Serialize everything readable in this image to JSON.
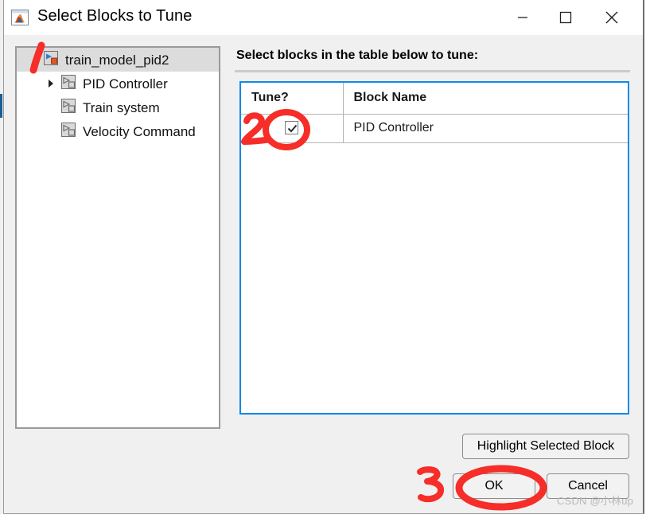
{
  "window": {
    "title": "Select Blocks to Tune",
    "app_icon": "simulink-icon",
    "controls": {
      "minimize_label": "Minimize",
      "maximize_label": "Maximize",
      "close_label": "Close"
    }
  },
  "tree": {
    "items": [
      {
        "label": "train_model_pid2",
        "icon": "simulink-model-icon",
        "selected": true,
        "depth": 0,
        "expandable": false,
        "expanded": false
      },
      {
        "label": "PID Controller",
        "icon": "simulink-block-icon",
        "selected": false,
        "depth": 1,
        "expandable": true,
        "expanded": false
      },
      {
        "label": "Train system",
        "icon": "simulink-block-icon",
        "selected": false,
        "depth": 1,
        "expandable": false,
        "expanded": false
      },
      {
        "label": "Velocity Command",
        "icon": "simulink-block-icon",
        "selected": false,
        "depth": 1,
        "expandable": false,
        "expanded": false
      }
    ]
  },
  "main": {
    "caption": "Select blocks in the table below to tune:",
    "table": {
      "columns": [
        "Tune?",
        "Block Name"
      ],
      "rows": [
        {
          "tune_checked": true,
          "block_name": "PID Controller"
        }
      ]
    }
  },
  "buttons": {
    "highlight": "Highlight Selected Block",
    "ok": "OK",
    "cancel": "Cancel"
  },
  "annotations": {
    "marks": [
      {
        "name": "stroke-1",
        "label": "1"
      },
      {
        "name": "circle-2",
        "label": "2"
      },
      {
        "name": "circle-3",
        "label": "3"
      }
    ],
    "color": "#f62d28"
  },
  "watermark": {
    "text": "CSDN @小林up"
  },
  "colors": {
    "accent_blue": "#0f8cea",
    "panel_bg": "#f0f0f0",
    "annotation_red": "#f62d28",
    "tree_selected": "#dcdcdc"
  }
}
